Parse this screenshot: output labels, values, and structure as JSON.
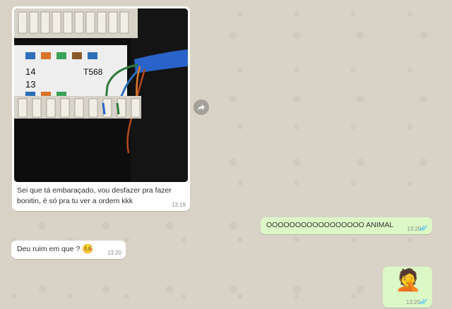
{
  "messages": [
    {
      "id": "m1",
      "direction": "incoming",
      "type": "image",
      "caption": "Sei que tá embaraçado, vou desfazer pra fazer bonitin, é só pra tu ver a ordem kkk",
      "time": "13:19"
    },
    {
      "id": "m2",
      "direction": "outgoing",
      "type": "text",
      "text": "OOOOOOOOOOOOOOOOO ANIMAL",
      "time": "13:20",
      "status": "read"
    },
    {
      "id": "m3",
      "direction": "incoming",
      "type": "text",
      "text": "Deu ruim em que ?",
      "emoji": "🤒",
      "time": "13:20"
    },
    {
      "id": "m4",
      "direction": "outgoing",
      "type": "emoji",
      "emoji": "🤦",
      "time": "13:20",
      "status": "read"
    }
  ],
  "photo_labels": [
    "14",
    "13",
    "T568"
  ],
  "icons": {
    "forward": "forward-icon",
    "read_receipt": "double-check-icon"
  },
  "colors": {
    "incoming_bubble": "#ffffff",
    "outgoing_bubble": "#dcf8c6",
    "read_ticks": "#4fc3f7",
    "wallpaper": "#d9d2c6"
  }
}
